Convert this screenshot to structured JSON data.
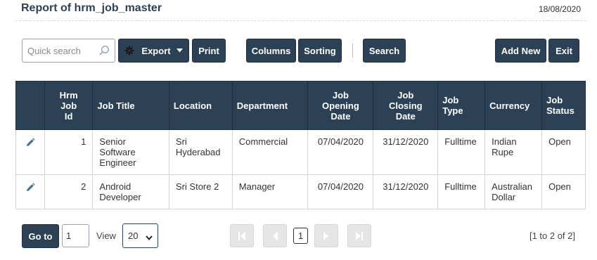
{
  "header": {
    "title": "Report of hrm_job_master",
    "date": "18/08/2020"
  },
  "toolbar": {
    "search_placeholder": "Quick search",
    "export_label": "Export",
    "print_label": "Print",
    "columns_label": "Columns",
    "sorting_label": "Sorting",
    "search_label": "Search",
    "add_new_label": "Add New",
    "exit_label": "Exit"
  },
  "table": {
    "headers": {
      "id": [
        "Hrm",
        "Job",
        "Id"
      ],
      "title": "Job Title",
      "location": "Location",
      "department": "Department",
      "opening": [
        "Job",
        "Opening",
        "Date"
      ],
      "closing": [
        "Job",
        "Closing",
        "Date"
      ],
      "type": [
        "Job",
        "Type"
      ],
      "currency": "Currency",
      "status": [
        "Job",
        "Status"
      ]
    },
    "rows": [
      {
        "id": "1",
        "title": [
          "Senior",
          "Software",
          "Engineer"
        ],
        "location": [
          "Sri",
          "Hyderabad"
        ],
        "department": "Commercial",
        "opening": "07/04/2020",
        "closing": "31/12/2020",
        "type": "Fulltime",
        "currency": [
          "Indian",
          "Rupe"
        ],
        "status": "Open"
      },
      {
        "id": "2",
        "title": [
          "Android",
          "Developer"
        ],
        "location": [
          "Sri Store 2"
        ],
        "department": "Manager",
        "opening": "07/04/2020",
        "closing": "31/12/2020",
        "type": "Fulltime",
        "currency": [
          "Australian",
          "Dollar"
        ],
        "status": "Open"
      }
    ]
  },
  "pagination": {
    "goto_label": "Go to",
    "goto_value": "1",
    "view_label": "View",
    "view_value": "20",
    "current_page": "1",
    "range_text": "[1 to 2 of 2]"
  },
  "colors": {
    "primary": "#2d4156",
    "disabled": "#e6e6e6",
    "edit_icon": "#3c6e96"
  }
}
